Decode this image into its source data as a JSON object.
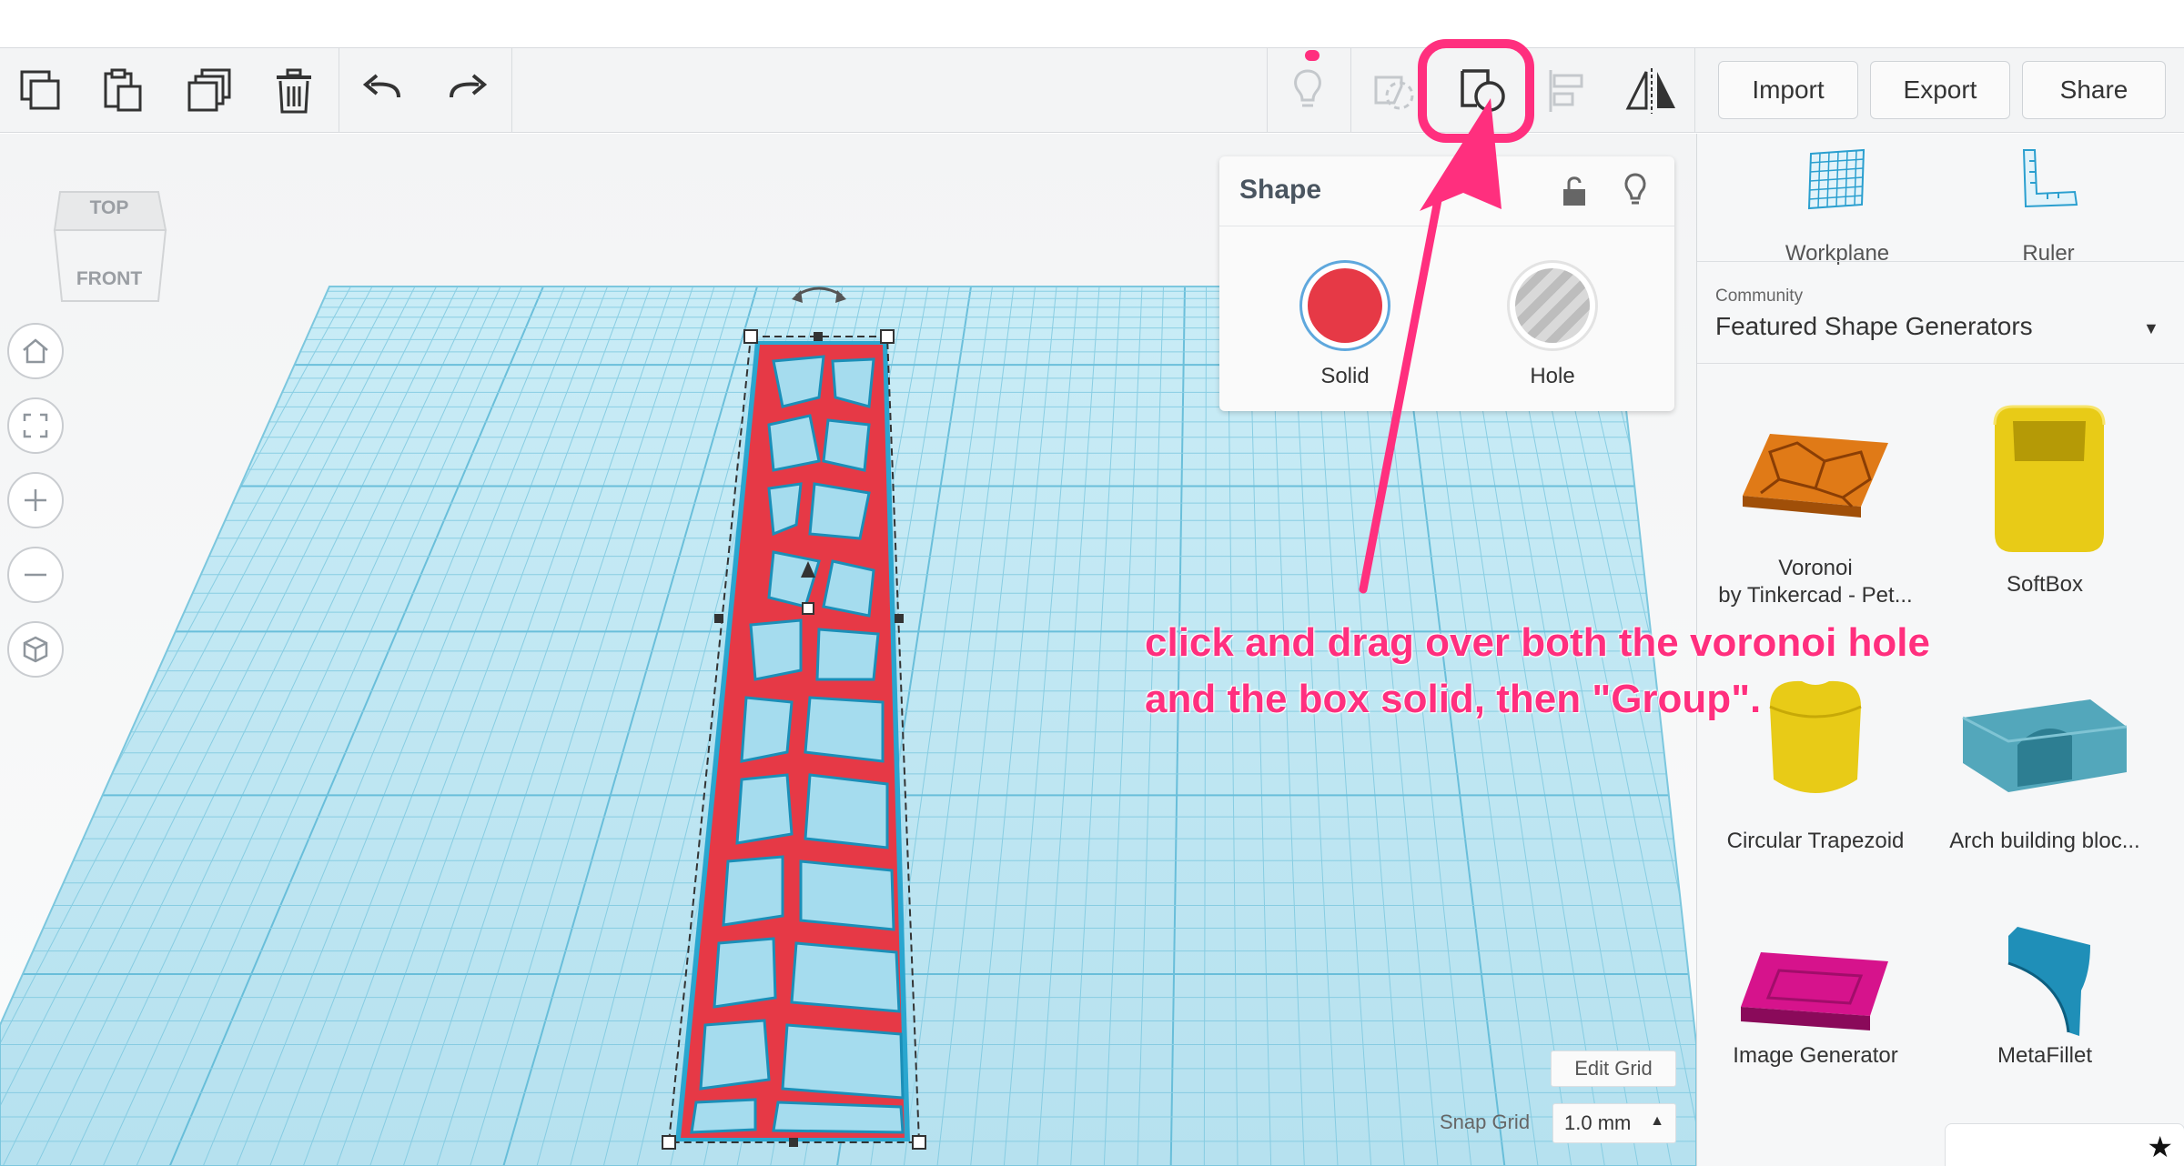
{
  "toolbar": {
    "import_label": "Import",
    "export_label": "Export",
    "share_label": "Share"
  },
  "viewcube": {
    "top": "TOP",
    "front": "FRONT"
  },
  "shape_panel": {
    "title": "Shape",
    "solid_label": "Solid",
    "hole_label": "Hole",
    "solid_color": "#e63946",
    "hole_color": "#b5b5b5"
  },
  "grid": {
    "edit_grid_label": "Edit Grid",
    "snap_grid_label": "Snap Grid",
    "snap_value": "1.0 mm"
  },
  "right_panel": {
    "workplane_label": "Workplane",
    "ruler_label": "Ruler",
    "community_label": "Community",
    "library_title": "Featured Shape Generators",
    "shapes": [
      {
        "name": "Voronoi",
        "byline": "by Tinkercad - Pet...",
        "color": "#e07a17"
      },
      {
        "name": "SoftBox",
        "byline": "",
        "color": "#e8cb17"
      },
      {
        "name": "Circular Trapezoid",
        "byline": "",
        "color": "#e8cb17"
      },
      {
        "name": "Arch building bloc...",
        "byline": "",
        "color": "#53a7bb"
      },
      {
        "name": "Image Generator",
        "byline": "",
        "color": "#d6138c"
      },
      {
        "name": "MetaFillet",
        "byline": "",
        "color": "#1f8fb8"
      }
    ]
  },
  "annotation": {
    "text_line1": "click and drag over both the voronoi hole",
    "text_line2": "and the box solid, then \"Group\".",
    "color": "#ff2f7e"
  },
  "colors": {
    "accent_pink": "#ff2f7e",
    "grid_blue": "#a9dff0",
    "object_red": "#e63946"
  }
}
